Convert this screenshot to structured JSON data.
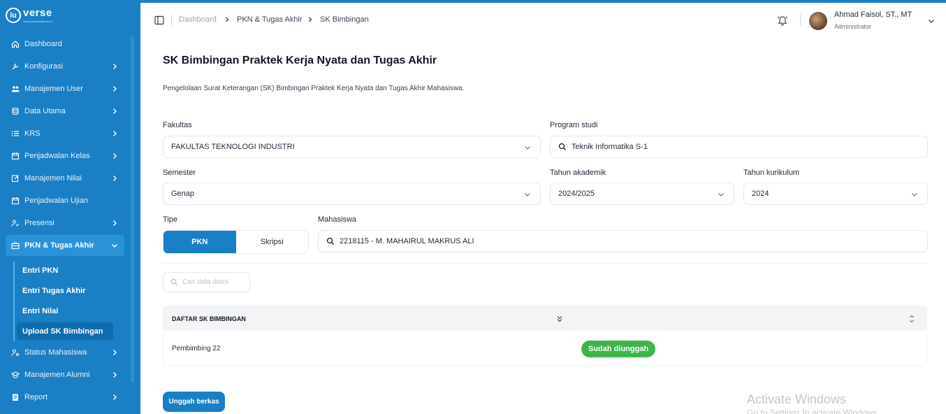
{
  "brand": {
    "logo_letters": "iu",
    "name": "verse",
    "tagline": "verse.paramadina.ac.id"
  },
  "sidebar": {
    "items": [
      {
        "label": "Dashboard",
        "icon": "home-icon"
      },
      {
        "label": "Konfigurasi",
        "icon": "wrench-icon"
      },
      {
        "label": "Manajemen User",
        "icon": "users-icon"
      },
      {
        "label": "Data Utama",
        "icon": "database-icon"
      },
      {
        "label": "KRS",
        "icon": "list-icon"
      },
      {
        "label": "Penjadwalan Kelas",
        "icon": "calendar-icon"
      },
      {
        "label": "Manajemen Nilai",
        "icon": "edit-icon"
      },
      {
        "label": "Penjadwalan Ujian",
        "icon": "calendar-icon"
      },
      {
        "label": "Presensi",
        "icon": "user-check-icon"
      },
      {
        "label": "PKN & Tugas Akhir",
        "icon": "briefcase-icon"
      },
      {
        "label": "Status Mahasiswa",
        "icon": "user-cog-icon"
      },
      {
        "label": "Manajemen Alumni",
        "icon": "graduation-icon"
      },
      {
        "label": "Report",
        "icon": "report-icon"
      }
    ],
    "subitems": [
      "Entri PKN",
      "Entri Tugas Akhir",
      "Entri Nilai",
      "Upload SK Bimbingan"
    ]
  },
  "breadcrumb": [
    "Dashboard",
    "PKN & Tugas Akhir",
    "SK Bimbingan"
  ],
  "user": {
    "name": "Ahmad Faisol, ST., MT",
    "role": "Administrator"
  },
  "page": {
    "title": "SK Bimbingan Praktek Kerja Nyata dan Tugas Akhir",
    "description": "Pengelolaan Surat Keterangan (SK) Bimbingan Praktek Kerja Nyata dan Tugas Akhir Mahasiswa."
  },
  "form": {
    "fakultas": {
      "label": "Fakultas",
      "value": "FAKULTAS TEKNOLOGI INDUSTRI"
    },
    "program_studi": {
      "label": "Program studi",
      "value": "Teknik Informatika S-1"
    },
    "semester": {
      "label": "Semester",
      "value": "Genap"
    },
    "tahun_akademik": {
      "label": "Tahun akademik",
      "value": "2024/2025"
    },
    "tahun_kurikulum": {
      "label": "Tahun kurikulum",
      "value": "2024"
    },
    "tipe": {
      "label": "Tipe",
      "options": [
        "PKN",
        "Skripsi"
      ],
      "selected": "PKN"
    },
    "mahasiswa": {
      "label": "Mahasiswa",
      "value": "2218115 - M. MAHAIRUL MAKRUS ALI"
    }
  },
  "search": {
    "placeholder": "Cari data disini"
  },
  "table": {
    "header": "DAFTAR SK BIMBINGAN",
    "rows": [
      {
        "name": "Pembimbing 22",
        "status": "Sudah diunggah"
      }
    ]
  },
  "actions": {
    "upload_label": "Unggah berkas"
  },
  "watermark": {
    "line1": "Activate Windows",
    "line2": "Go to Settings to activate Windows."
  },
  "colors": {
    "primary": "#1a7fc4",
    "success": "#3db54a"
  }
}
